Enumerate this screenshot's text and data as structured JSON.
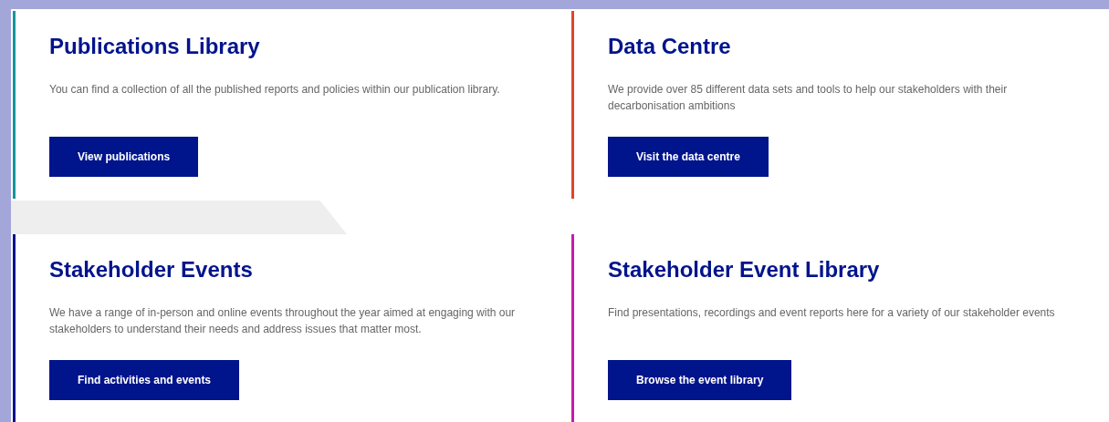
{
  "cards": [
    {
      "title": "Publications Library",
      "text": "You can find a collection of all the published reports and policies within our publication library.",
      "button": "View publications",
      "color": "#17959c"
    },
    {
      "title": "Data Centre",
      "text": "We provide over 85 different data sets and tools to help our stakeholders with their decarbonisation ambitions",
      "button": "Visit the data centre",
      "color": "#e0452b"
    },
    {
      "title": "Stakeholder Events",
      "text": "We have a range of in-person and online events throughout the year aimed at engaging with our stakeholders to understand their needs and address issues that matter most.",
      "button": "Find activities and events",
      "color": "#00148c"
    },
    {
      "title": "Stakeholder Event Library",
      "text": "Find presentations, recordings and event reports here for a variety of our stakeholder events",
      "button": "Browse the event library",
      "color": "#c71aaf"
    }
  ]
}
